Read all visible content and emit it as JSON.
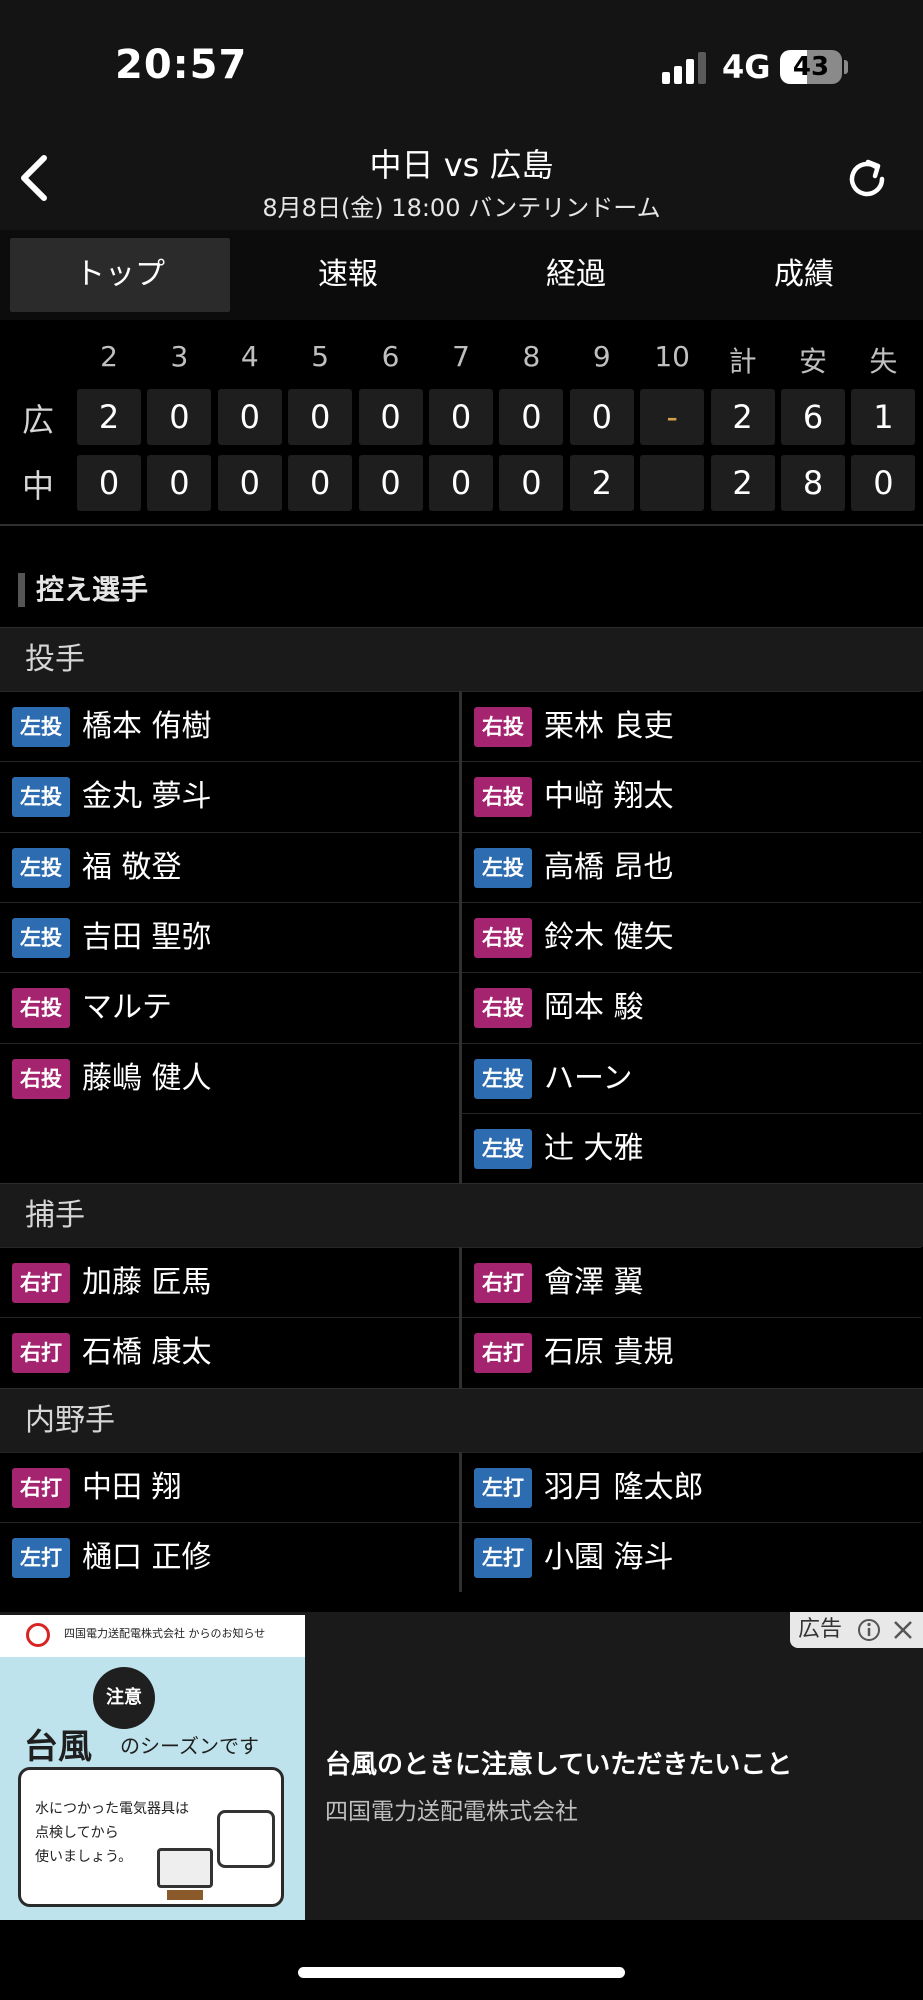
{
  "status_bar": {
    "time": "20:57",
    "network": "4G",
    "battery": "43",
    "battery_level": 0.43,
    "signal_bars": 3
  },
  "header": {
    "title": "中日 vs 広島",
    "subtitle": "8月8日(金) 18:00 バンテリンドーム",
    "back_icon": "chevron-left-icon",
    "refresh_icon": "refresh-icon"
  },
  "tabs": [
    {
      "label": "トップ",
      "active": true
    },
    {
      "label": "速報",
      "active": false
    },
    {
      "label": "経過",
      "active": false
    },
    {
      "label": "成績",
      "active": false
    }
  ],
  "scoreboard": {
    "headers": [
      "2",
      "3",
      "4",
      "5",
      "6",
      "7",
      "8",
      "9",
      "10",
      "計",
      "安",
      "失"
    ],
    "teams": [
      {
        "label": "広",
        "cells": [
          "2",
          "0",
          "0",
          "0",
          "0",
          "0",
          "0",
          "0",
          "-",
          "2",
          "6",
          "1"
        ]
      },
      {
        "label": "中",
        "cells": [
          "0",
          "0",
          "0",
          "0",
          "0",
          "0",
          "0",
          "2",
          "",
          "2",
          "8",
          "0"
        ]
      }
    ],
    "dash_color": "#d4a04a"
  },
  "bench": {
    "title": "控え選手",
    "groups": [
      {
        "label": "投手",
        "left": [
          {
            "hand": "左投",
            "name": "橋本 侑樹",
            "side": "left"
          },
          {
            "hand": "左投",
            "name": "金丸 夢斗",
            "side": "left"
          },
          {
            "hand": "左投",
            "name": "福 敬登",
            "side": "left"
          },
          {
            "hand": "左投",
            "name": "吉田 聖弥",
            "side": "left"
          },
          {
            "hand": "右投",
            "name": "マルテ",
            "side": "right"
          },
          {
            "hand": "右投",
            "name": "藤嶋 健人",
            "side": "right"
          }
        ],
        "right": [
          {
            "hand": "右投",
            "name": "栗林 良吏",
            "side": "right"
          },
          {
            "hand": "右投",
            "name": "中﨑 翔太",
            "side": "right"
          },
          {
            "hand": "左投",
            "name": "高橋 昂也",
            "side": "left"
          },
          {
            "hand": "右投",
            "name": "鈴木 健矢",
            "side": "right"
          },
          {
            "hand": "右投",
            "name": "岡本 駿",
            "side": "right"
          },
          {
            "hand": "左投",
            "name": "ハーン",
            "side": "left"
          },
          {
            "hand": "左投",
            "name": "辻 大雅",
            "side": "left"
          }
        ]
      },
      {
        "label": "捕手",
        "left": [
          {
            "hand": "右打",
            "name": "加藤 匠馬",
            "side": "right"
          },
          {
            "hand": "右打",
            "name": "石橋 康太",
            "side": "right"
          }
        ],
        "right": [
          {
            "hand": "右打",
            "name": "會澤 翼",
            "side": "right"
          },
          {
            "hand": "右打",
            "name": "石原 貴規",
            "side": "right"
          }
        ]
      },
      {
        "label": "内野手",
        "left": [
          {
            "hand": "右打",
            "name": "中田 翔",
            "side": "right"
          },
          {
            "hand": "左打",
            "name": "樋口 正修",
            "side": "left"
          }
        ],
        "right": [
          {
            "hand": "左打",
            "name": "羽月 隆太郎",
            "side": "left"
          },
          {
            "hand": "左打",
            "name": "小園 海斗",
            "side": "left"
          }
        ]
      }
    ],
    "colors": {
      "left": "#2d6cb0",
      "right": "#a5246f"
    }
  },
  "ad": {
    "image_header": "四国電力送配電株式会社 からのお知らせ",
    "image_bubble": "注意",
    "image_title": "台風",
    "image_season": "のシーズンです",
    "image_lines": [
      "水につかった電気器具は",
      "点検してから",
      "使いましょう。"
    ],
    "headline": "台風のときに注意していただきたいこと",
    "sponsor": "四国電力送配電株式会社",
    "tag": "広告",
    "info_icon": "info-icon",
    "close_icon": "close-icon"
  }
}
